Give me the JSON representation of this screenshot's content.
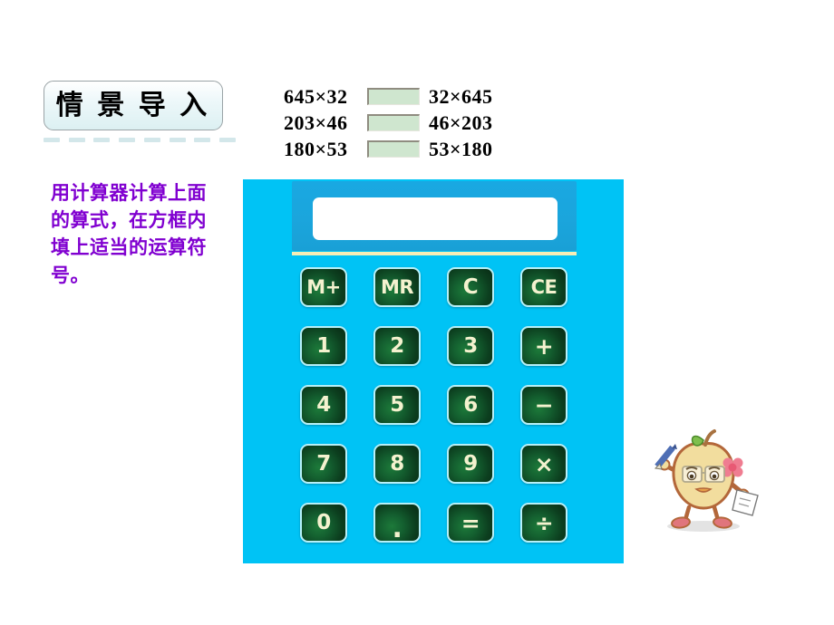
{
  "slide": {
    "background_color": "#ffffff",
    "title_badge": {
      "label": "情 景 导 入",
      "border_color": "#9aa3a6",
      "fill_color": "#e4f3f5"
    },
    "underline_dash_color": "#d3e7ea",
    "instruction": {
      "text": "用计算器计算上面的算式，在方框内填上适当的运算符号。",
      "color": "#8000d0"
    }
  },
  "equations": {
    "box_fill_color": "#cfe6cf",
    "rows": [
      {
        "left": "645×32",
        "box": "",
        "right": "32×645"
      },
      {
        "left": "203×46",
        "box": "",
        "right": "46×203"
      },
      {
        "left": "180×53",
        "box": "",
        "right": "53×180"
      }
    ]
  },
  "calculator": {
    "body_color": "#00c3f5",
    "display_panel_color": "#1ba5dc",
    "screen_value": "",
    "divider_color": "#f6edb6",
    "key_face_color": "#125c2e",
    "key_border_color": "#b6f0f8",
    "key_text_color": "#f4f2cf",
    "keys": [
      {
        "label": "M+",
        "name": "memory-add"
      },
      {
        "label": "MR",
        "name": "memory-recall"
      },
      {
        "label": "C",
        "name": "clear"
      },
      {
        "label": "CE",
        "name": "clear-entry"
      },
      {
        "label": "1",
        "name": "digit-1"
      },
      {
        "label": "2",
        "name": "digit-2"
      },
      {
        "label": "3",
        "name": "digit-3"
      },
      {
        "label": "+",
        "name": "plus"
      },
      {
        "label": "4",
        "name": "digit-4"
      },
      {
        "label": "5",
        "name": "digit-5"
      },
      {
        "label": "6",
        "name": "digit-6"
      },
      {
        "label": "−",
        "name": "minus"
      },
      {
        "label": "7",
        "name": "digit-7"
      },
      {
        "label": "8",
        "name": "digit-8"
      },
      {
        "label": "9",
        "name": "digit-9"
      },
      {
        "label": "×",
        "name": "multiply"
      },
      {
        "label": "0",
        "name": "digit-0"
      },
      {
        "label": ".",
        "name": "decimal-point"
      },
      {
        "label": "=",
        "name": "equals"
      },
      {
        "label": "÷",
        "name": "divide"
      }
    ]
  },
  "mascot": {
    "name": "apple-character",
    "body_color": "#f2dd9e",
    "outline_color": "#b3673a",
    "flower_color": "#ef7d91",
    "pencil_color": "#4f6fb5",
    "shoe_color": "#e0757c",
    "leaf_color": "#7fbf4d"
  }
}
